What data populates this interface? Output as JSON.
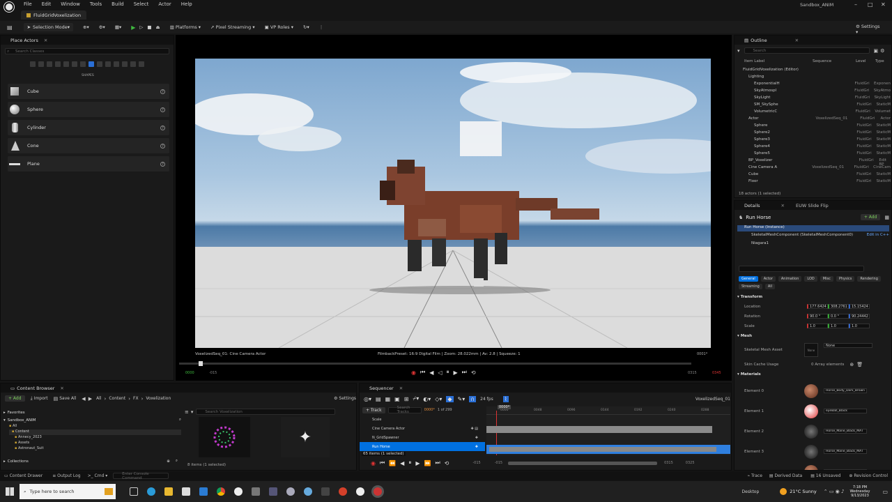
{
  "app": {
    "project_title": "FluidGridVoxelization",
    "project_name": "Sandbox_ANIM"
  },
  "menu": [
    "File",
    "Edit",
    "Window",
    "Tools",
    "Build",
    "Select",
    "Actor",
    "Help"
  ],
  "toolbar": {
    "selection_mode": "Selection Mode",
    "platforms": "Platforms",
    "pixel_streaming": "Pixel Streaming",
    "vp_roles": "VP Roles",
    "settings": "Settings"
  },
  "place_actors": {
    "tab": "Place Actors",
    "search_placeholder": "Search Classes",
    "category": "SHAPES",
    "items": [
      "Cube",
      "Sphere",
      "Cylinder",
      "Cone",
      "Plane"
    ]
  },
  "viewport": {
    "camera_label": "VoxelizedSeq_01: Cine Camera Actor",
    "filmback": "FilmbackPreset: 16:9 Digital Film | Zoom: 28.022mm | Av: 2.8 | Squeeze: 1",
    "frame_right": "0001*",
    "frame_start": "0000",
    "frame_in": "-015",
    "frame_end": "0315",
    "frame_out": "0345"
  },
  "outliner": {
    "tab": "Outline",
    "search_placeholder": "Search",
    "columns": [
      "Item Label",
      "Sequence",
      "Level",
      "Type"
    ],
    "items": [
      {
        "name": "FluidGridVoxelization (Editor)",
        "seq": "",
        "lvl": "",
        "type": "",
        "indent": 1
      },
      {
        "name": "Lighting",
        "seq": "",
        "lvl": "",
        "type": "",
        "indent": 2
      },
      {
        "name": "ExponentialH",
        "seq": "",
        "lvl": "FluidGri",
        "type": "Exponen",
        "indent": 3
      },
      {
        "name": "SkyAtmospl",
        "seq": "",
        "lvl": "FluidGri",
        "type": "SkyAtmo",
        "indent": 3
      },
      {
        "name": "SkyLight",
        "seq": "",
        "lvl": "FluidGri",
        "type": "SkyLight",
        "indent": 3
      },
      {
        "name": "SM_SkySphe",
        "seq": "",
        "lvl": "FluidGri",
        "type": "StaticM",
        "indent": 3
      },
      {
        "name": "VolumetricC",
        "seq": "",
        "lvl": "FluidGri",
        "type": "Volumet",
        "indent": 3
      },
      {
        "name": "Actor",
        "seq": "VoxelizedSeq_01",
        "lvl": "FluidGri",
        "type": "Actor",
        "indent": 2
      },
      {
        "name": "Sphere",
        "seq": "",
        "lvl": "FluidGri",
        "type": "StaticM",
        "indent": 3
      },
      {
        "name": "Sphere2",
        "seq": "",
        "lvl": "FluidGri",
        "type": "StaticM",
        "indent": 3
      },
      {
        "name": "Sphere3",
        "seq": "",
        "lvl": "FluidGri",
        "type": "StaticM",
        "indent": 3
      },
      {
        "name": "Sphere4",
        "seq": "",
        "lvl": "FluidGri",
        "type": "StaticM",
        "indent": 3
      },
      {
        "name": "Sphere5",
        "seq": "",
        "lvl": "FluidGri",
        "type": "StaticM",
        "indent": 3
      },
      {
        "name": "BP_Voxelizer",
        "seq": "",
        "lvl": "FluidGri",
        "type": "Edit BP",
        "indent": 2
      },
      {
        "name": "Cine Camera A",
        "seq": "VoxelizedSeq_01",
        "lvl": "FluidGri",
        "type": "CineCam",
        "indent": 2
      },
      {
        "name": "Cube",
        "seq": "",
        "lvl": "FluidGri",
        "type": "StaticM",
        "indent": 2
      },
      {
        "name": "Floor",
        "seq": "",
        "lvl": "FluidGri",
        "type": "StaticM",
        "indent": 2
      }
    ],
    "status": "18 actors (1 selected)"
  },
  "details": {
    "tab": "Details",
    "tab2": "EUW Slide Flip",
    "actor": "Run Horse",
    "add": "+ Add",
    "instance": "Run Horse (Instance)",
    "component": "SkeletalMeshComponent (SkeletalMeshComponent0)",
    "edit_cpp": "Edit in C++",
    "niagara": "Niagara1",
    "filters": [
      "General",
      "Actor",
      "Animation",
      "LOD",
      "Misc",
      "Physics",
      "Rendering",
      "Streaming",
      "All"
    ],
    "transform_header": "Transform",
    "location": {
      "label": "Location",
      "x": "177.6424",
      "y": "308.2761",
      "z": "15.15424"
    },
    "rotation": {
      "label": "Rotation",
      "x": "90.0 °",
      "y": "0.0 °",
      "z": "90.24442"
    },
    "scale": {
      "label": "Scale",
      "x": "1.0",
      "y": "1.0",
      "z": "1.0"
    },
    "mesh_header": "Mesh",
    "skeletal_mesh": "Skeletal Mesh Asset",
    "mesh_value": "None",
    "mesh_thumb": "None",
    "skin_cache": "Skin Cache Usage",
    "skin_value": "0 Array elements",
    "materials_header": "Materials",
    "materials": [
      {
        "slot": "Element 0",
        "name": "Horse_Body_Dark_Brown"
      },
      {
        "slot": "Element 1",
        "name": "eyeBall_Black"
      },
      {
        "slot": "Element 2",
        "name": "Horse_Mane_Black_MAT"
      },
      {
        "slot": "Element 3",
        "name": "Horse_Mane_Black_MAT"
      },
      {
        "slot": "Element 4",
        "name": "Horse_Body_Dark_Brown"
      }
    ]
  },
  "content_browser": {
    "tab": "Content Browser",
    "add": "+ Add",
    "import": "Import",
    "save_all": "Save All",
    "path": [
      "All",
      "Content",
      "FX",
      "Voxelization"
    ],
    "settings": "Settings",
    "favorites": "Favorites",
    "root": "Sandbox_ANIM",
    "tree": [
      "All",
      "Content",
      "Annecy_2023",
      "Assets",
      "Astronaut_Suit"
    ],
    "search_placeholder": "Search Voxelization",
    "collections": "Collections",
    "status": "8 items (1 selected)"
  },
  "sequencer": {
    "tab": "Sequencer",
    "fps": "24 fps",
    "seq_name": "VoxelizedSeq_01",
    "track": "+ Track",
    "search_placeholder": "Search Tracks",
    "current_frame": "0000*",
    "frame_count": "1 of 299",
    "playhead": "0000*",
    "tracks": [
      "Scale",
      "Cine Camera Actor",
      "N_GridSpawner",
      "Run Horse"
    ],
    "status": "65 items (1 selected)",
    "range_start": "-015",
    "range_in": "-015",
    "range_out": "0315",
    "range_end": "0325",
    "ruler": [
      "0000",
      "0048",
      "0096",
      "0144",
      "0192",
      "0240",
      "0288"
    ]
  },
  "statusbar": {
    "content_drawer": "Content Drawer",
    "output_log": "Output Log",
    "cmd": "Cmd",
    "console_placeholder": "Enter Console Command",
    "trace": "Trace",
    "derived_data": "Derived Data",
    "unsaved": "16 Unsaved",
    "revision": "Revision Control"
  },
  "taskbar": {
    "search_placeholder": "Type here to search",
    "desktop": "Desktop",
    "weather": "21°C Sunny",
    "time": "7:18 PM",
    "day": "Wednesday",
    "date": "9/13/2023"
  },
  "colors": {
    "accent": "#0070e0",
    "panel": "#1a1a1a",
    "bg": "#151515",
    "play": "#3fb93f",
    "record": "#d33"
  }
}
